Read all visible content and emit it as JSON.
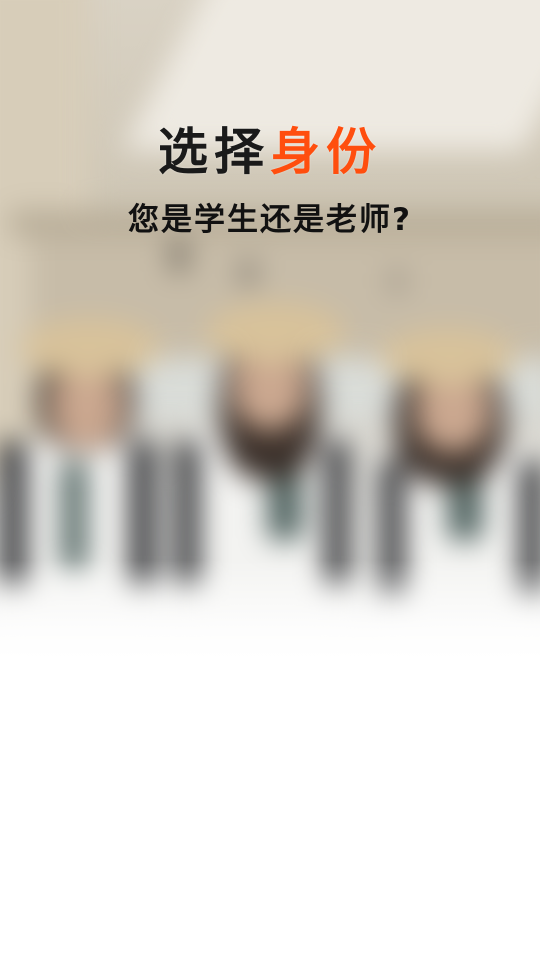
{
  "header": {
    "title_part1": "选择",
    "title_part2": "身份",
    "subtitle": "您是学生还是老师?"
  },
  "colors": {
    "title_dark": "#1a1a1a",
    "title_accent": "#ff4e0e",
    "background": "#ffffff"
  }
}
